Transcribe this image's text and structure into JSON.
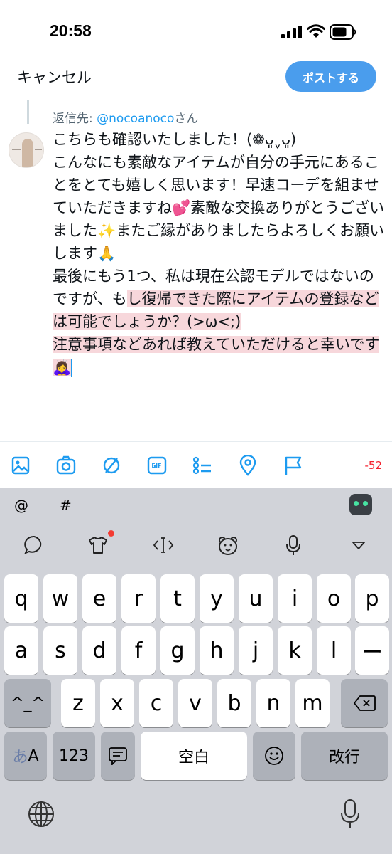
{
  "status_bar": {
    "time": "20:58"
  },
  "header": {
    "cancel_label": "キャンセル",
    "post_label": "ポストする"
  },
  "reply": {
    "prefix": "返信先: ",
    "handle": "@nocoanoco",
    "suffix": "さん"
  },
  "compose": {
    "text_plain": "こちらも確認いたしました！(❁ᴗ͈ˬᴗ͈)\nこんなにも素敵なアイテムが自分の手元にあることをとても嬉しく思います！早速コーデを組ませていただきますね💕素敵な交換ありがとうございました✨またご縁がありましたらよろしくお願いします🙏\n最後にもう1つ、私は現在公認モデルではないのですが、も",
    "text_highlighted": "し復帰できた際にアイテムの登録などは可能でしょうか？(>ω<;)\n注意事項などあれば教えていただけると幸いです🙇‍♀️"
  },
  "toolbar": {
    "icons": [
      "image-icon",
      "camera-icon",
      "slash-circle-icon",
      "gif-icon",
      "list-icon",
      "location-icon",
      "flag-icon"
    ],
    "char_count": "-52",
    "accent_color": "#1d9bf0",
    "over_limit_color": "#f4212e"
  },
  "keyboard": {
    "symbols": [
      "@",
      "#"
    ],
    "row1": [
      "q",
      "w",
      "e",
      "r",
      "t",
      "y",
      "u",
      "i",
      "o",
      "p"
    ],
    "row2": [
      "a",
      "s",
      "d",
      "f",
      "g",
      "h",
      "j",
      "k",
      "l",
      "ー"
    ],
    "row3": [
      "z",
      "x",
      "c",
      "v",
      "b",
      "n",
      "m"
    ],
    "shift_label": "^_^",
    "mode_label_a": "あ",
    "mode_label_b": "A",
    "numbers_label": "123",
    "space_label": "空白",
    "return_label": "改行"
  }
}
